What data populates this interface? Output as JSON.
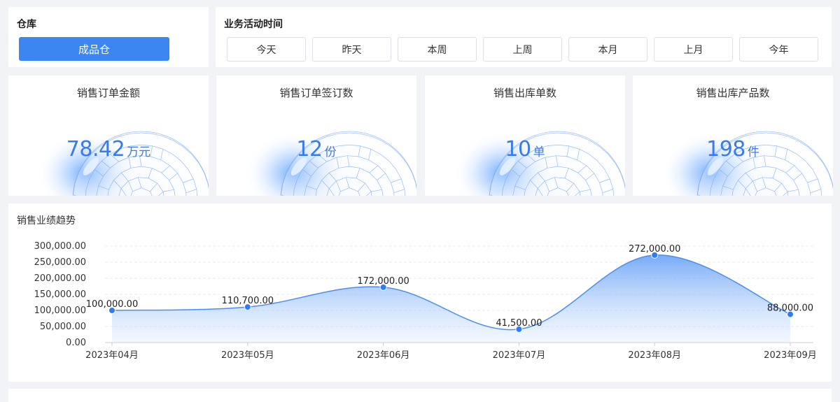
{
  "warehouse": {
    "title": "仓库",
    "selected": "成品仓"
  },
  "period": {
    "title": "业务活动时间",
    "options": [
      "今天",
      "昨天",
      "本周",
      "上周",
      "本月",
      "上月",
      "今年"
    ]
  },
  "kpis": [
    {
      "title": "销售订单金额",
      "value": "78.42",
      "unit": "万元"
    },
    {
      "title": "销售订单签订数",
      "value": "12",
      "unit": "份"
    },
    {
      "title": "销售出库单数",
      "value": "10",
      "unit": "单"
    },
    {
      "title": "销售出库产品数",
      "value": "198",
      "unit": "件"
    }
  ],
  "trend": {
    "title": "销售业绩趋势"
  },
  "colors": {
    "accent": "#3b86f0",
    "kpi_value": "#3a7bea",
    "line": "#4b8ef1"
  },
  "chart_data": {
    "type": "area",
    "categories": [
      "2023年04月",
      "2023年05月",
      "2023年06月",
      "2023年07月",
      "2023年08月",
      "2023年09月"
    ],
    "values": [
      100000,
      110700,
      172000,
      41500,
      272000,
      88000
    ],
    "data_labels": [
      "100,000.00",
      "110,700.00",
      "172,000.00",
      "41,500.00",
      "272,000.00",
      "88,000.00"
    ],
    "y_ticks": [
      "0.00",
      "50,000.00",
      "100,000.00",
      "150,000.00",
      "200,000.00",
      "250,000.00",
      "300,000.00"
    ],
    "ylim": [
      0,
      300000
    ],
    "grid": true,
    "smooth": true
  }
}
